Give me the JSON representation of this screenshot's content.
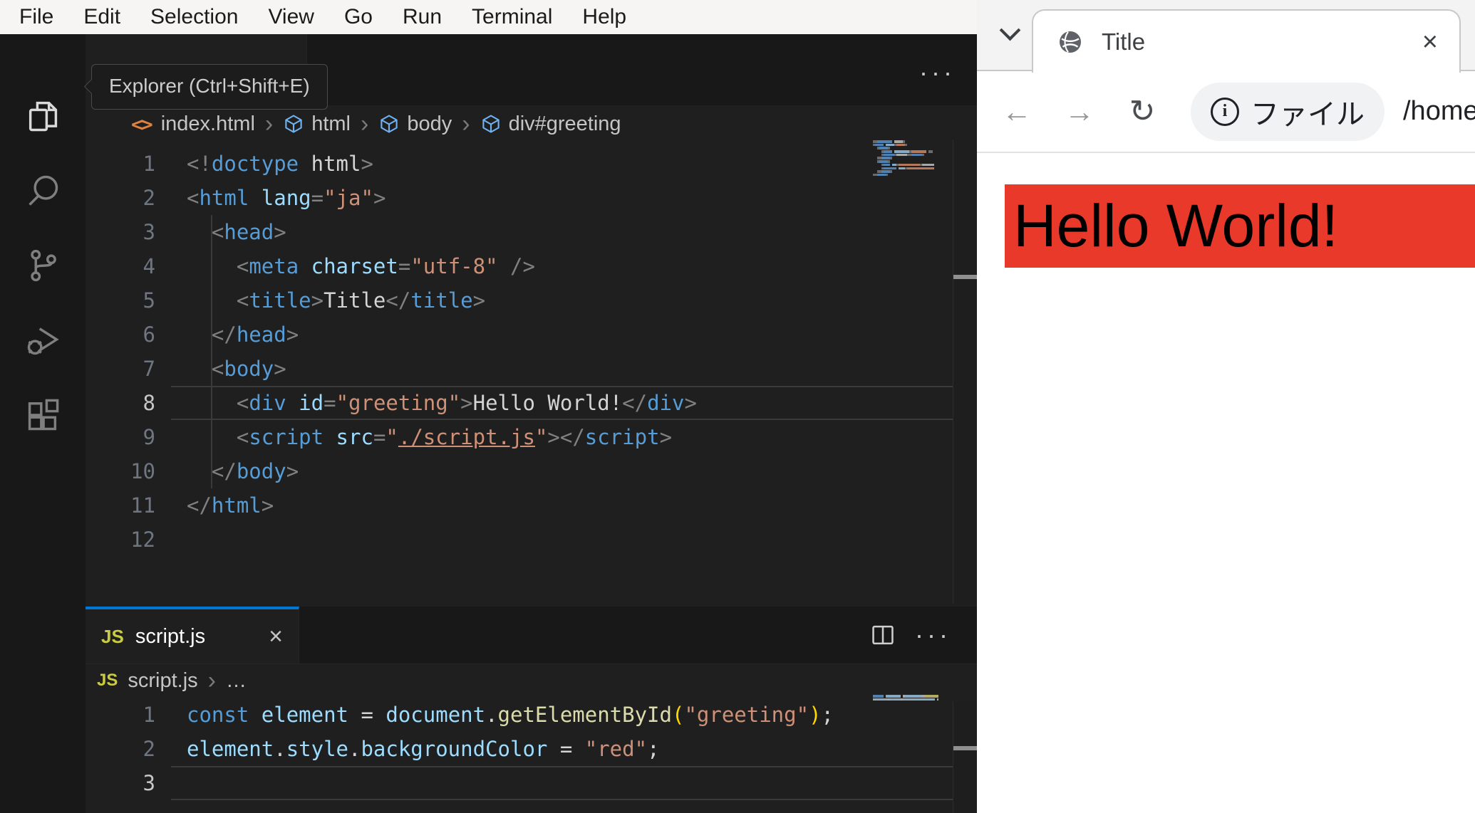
{
  "vscode": {
    "menu": [
      "File",
      "Edit",
      "Selection",
      "View",
      "Go",
      "Run",
      "Terminal",
      "Help"
    ],
    "activity_icons": [
      "explorer-icon",
      "search-icon",
      "source-control-icon",
      "run-debug-icon",
      "extensions-icon"
    ],
    "tooltip": "Explorer (Ctrl+Shift+E)",
    "editor_actions": {
      "more": "···"
    },
    "html_editor": {
      "breadcrumb": {
        "file_icon": "<>",
        "file": "index.html",
        "sep": "›",
        "symbols": [
          "html",
          "body",
          "div#greeting"
        ]
      },
      "active_line": 8,
      "lines": [
        [
          [
            "pun",
            "<!"
          ],
          [
            "tag",
            "doctype"
          ],
          [
            "pln",
            " html"
          ],
          [
            "pun",
            ">"
          ]
        ],
        [
          [
            "pun",
            "<"
          ],
          [
            "tag",
            "html"
          ],
          [
            "pln",
            " "
          ],
          [
            "attr",
            "lang"
          ],
          [
            "pun",
            "="
          ],
          [
            "str",
            "\"ja\""
          ],
          [
            "pun",
            ">"
          ]
        ],
        [
          [
            "pln",
            "  "
          ],
          [
            "pun",
            "<"
          ],
          [
            "tag",
            "head"
          ],
          [
            "pun",
            ">"
          ]
        ],
        [
          [
            "pln",
            "    "
          ],
          [
            "pun",
            "<"
          ],
          [
            "tag",
            "meta"
          ],
          [
            "pln",
            " "
          ],
          [
            "attr",
            "charset"
          ],
          [
            "pun",
            "="
          ],
          [
            "str",
            "\"utf-8\""
          ],
          [
            "pln",
            " "
          ],
          [
            "pun",
            "/>"
          ]
        ],
        [
          [
            "pln",
            "    "
          ],
          [
            "pun",
            "<"
          ],
          [
            "tag",
            "title"
          ],
          [
            "pun",
            ">"
          ],
          [
            "pln",
            "Title"
          ],
          [
            "pun",
            "</"
          ],
          [
            "tag",
            "title"
          ],
          [
            "pun",
            ">"
          ]
        ],
        [
          [
            "pln",
            "  "
          ],
          [
            "pun",
            "</"
          ],
          [
            "tag",
            "head"
          ],
          [
            "pun",
            ">"
          ]
        ],
        [
          [
            "pln",
            "  "
          ],
          [
            "pun",
            "<"
          ],
          [
            "tag",
            "body"
          ],
          [
            "pun",
            ">"
          ]
        ],
        [
          [
            "pln",
            "    "
          ],
          [
            "pun",
            "<"
          ],
          [
            "tag",
            "div"
          ],
          [
            "pln",
            " "
          ],
          [
            "attr",
            "id"
          ],
          [
            "pun",
            "="
          ],
          [
            "str",
            "\"greeting\""
          ],
          [
            "pun",
            ">"
          ],
          [
            "pln",
            "Hello World!"
          ],
          [
            "pun",
            "</"
          ],
          [
            "tag",
            "div"
          ],
          [
            "pun",
            ">"
          ]
        ],
        [
          [
            "pln",
            "    "
          ],
          [
            "pun",
            "<"
          ],
          [
            "tag",
            "script"
          ],
          [
            "pln",
            " "
          ],
          [
            "attr",
            "src"
          ],
          [
            "pun",
            "="
          ],
          [
            "str",
            "\""
          ],
          [
            "link",
            "./script.js"
          ],
          [
            "str",
            "\""
          ],
          [
            "pun",
            ">"
          ],
          [
            "pun",
            "</"
          ],
          [
            "tag",
            "script"
          ],
          [
            "pun",
            ">"
          ]
        ],
        [
          [
            "pln",
            "  "
          ],
          [
            "pun",
            "</"
          ],
          [
            "tag",
            "body"
          ],
          [
            "pun",
            ">"
          ]
        ],
        [
          [
            "pun",
            "</"
          ],
          [
            "tag",
            "html"
          ],
          [
            "pun",
            ">"
          ]
        ],
        []
      ]
    },
    "js_editor": {
      "tab": {
        "badge": "JS",
        "label": "script.js",
        "close": "×"
      },
      "breadcrumb": {
        "badge": "JS",
        "file": "script.js",
        "sep": "›",
        "more": "…"
      },
      "active_line": 3,
      "lines": [
        [
          [
            "kw",
            "const"
          ],
          [
            "pln",
            " "
          ],
          [
            "attr",
            "element"
          ],
          [
            "pln",
            " = "
          ],
          [
            "attr",
            "document"
          ],
          [
            "pln",
            "."
          ],
          [
            "fn",
            "getElementById"
          ],
          [
            "br",
            "("
          ],
          [
            "str",
            "\"greeting\""
          ],
          [
            "br",
            ")"
          ],
          [
            "pln",
            ";"
          ]
        ],
        [
          [
            "attr",
            "element"
          ],
          [
            "pln",
            "."
          ],
          [
            "attr",
            "style"
          ],
          [
            "pln",
            "."
          ],
          [
            "attr",
            "backgroundColor"
          ],
          [
            "pln",
            " = "
          ],
          [
            "str",
            "\"red\""
          ],
          [
            "pln",
            ";"
          ]
        ],
        []
      ]
    }
  },
  "browser": {
    "tab": {
      "title": "Title",
      "close": "×"
    },
    "toolbar": {
      "icons": {
        "back": "←",
        "forward": "→",
        "reload": "↻"
      },
      "chip_icon": "i",
      "chip_label": "ファイル",
      "url": "/home/u"
    },
    "page": {
      "greeting": "Hello World!",
      "background": "#e8392b"
    }
  }
}
